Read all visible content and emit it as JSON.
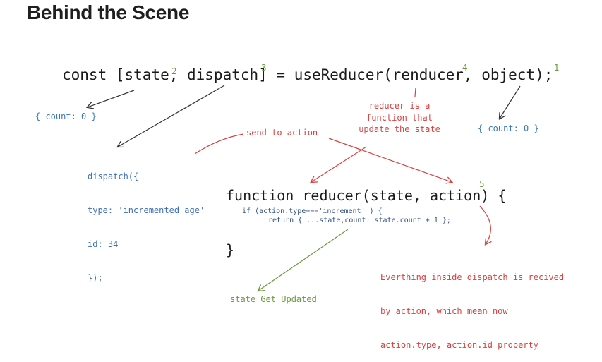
{
  "heading": "Behind the Scene",
  "code": {
    "main_line": "const [state, dispatch] = useReducer(renducer, object);",
    "function_signature": "function reducer(state, action) {",
    "if_line": "if (action.type==='increment' ) {",
    "return_line": "return { ...state,count: state.count + 1 };",
    "closing_brace": "}"
  },
  "numbers": {
    "n1": "1",
    "n2": "2",
    "n3": "3",
    "n4": "4",
    "n5": "5"
  },
  "annotations": {
    "count_left": "{ count: 0 }",
    "count_right": "{ count: 0 }",
    "dispatch_lines": [
      "dispatch({",
      "type: 'incremented_age'",
      "id: 34",
      "});"
    ],
    "send_to_action": "send to action",
    "reducer_note": "reducer is a function that update the state",
    "everything_lines": [
      "Everthing inside dispatch is recived",
      "by action, which mean now",
      "action.type, action.id property"
    ],
    "state_updated": "state Get Updated"
  },
  "colors": {
    "blue": "#3b78b8",
    "red": "#d9403f",
    "green": "#6a9a3a",
    "black": "#1b1b1b",
    "arrow_dark": "#333333"
  }
}
